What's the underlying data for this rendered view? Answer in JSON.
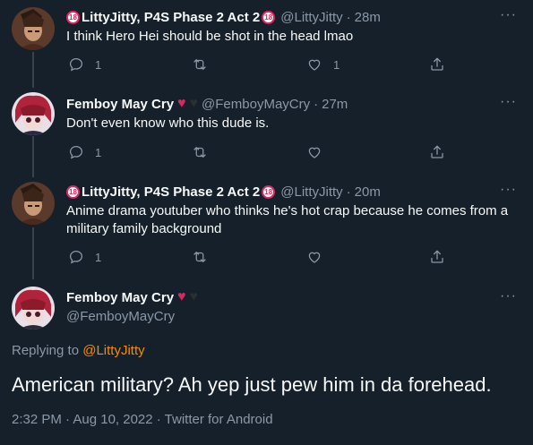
{
  "tweets": [
    {
      "name": "LittyJitty, P4S Phase 2 Act 2",
      "badge": "18",
      "handle": "@LittyJitty",
      "dot": "·",
      "time": "28m",
      "text": "I think Hero Hei should be shot in the head lmao",
      "replies": "1",
      "likes": "1"
    },
    {
      "name": "Femboy May Cry",
      "handle": "@FemboyMayCry",
      "dot": "·",
      "time": "27m",
      "text": "Don't even know who this dude is.",
      "replies": "1"
    },
    {
      "name": "LittyJitty, P4S Phase 2 Act 2",
      "badge": "18",
      "handle": "@LittyJitty",
      "dot": "·",
      "time": "20m",
      "text": "Anime drama youtuber who thinks he's hot crap because he comes from a military family background",
      "replies": "1"
    }
  ],
  "focused": {
    "name": "Femboy May Cry",
    "handle": "@FemboyMayCry",
    "replying_label": "Replying to",
    "replying_to": "@LittyJitty",
    "text": "American military? Ah yep just pew him in da forehead.",
    "timestamp": "2:32 PM · Aug 10, 2022 · Twitter for Android"
  },
  "more_glyph": "···",
  "colors": {
    "background": "#15202b",
    "secondary_text": "#8b98a5",
    "mention": "#f58a07",
    "heart": "#e0245e"
  }
}
